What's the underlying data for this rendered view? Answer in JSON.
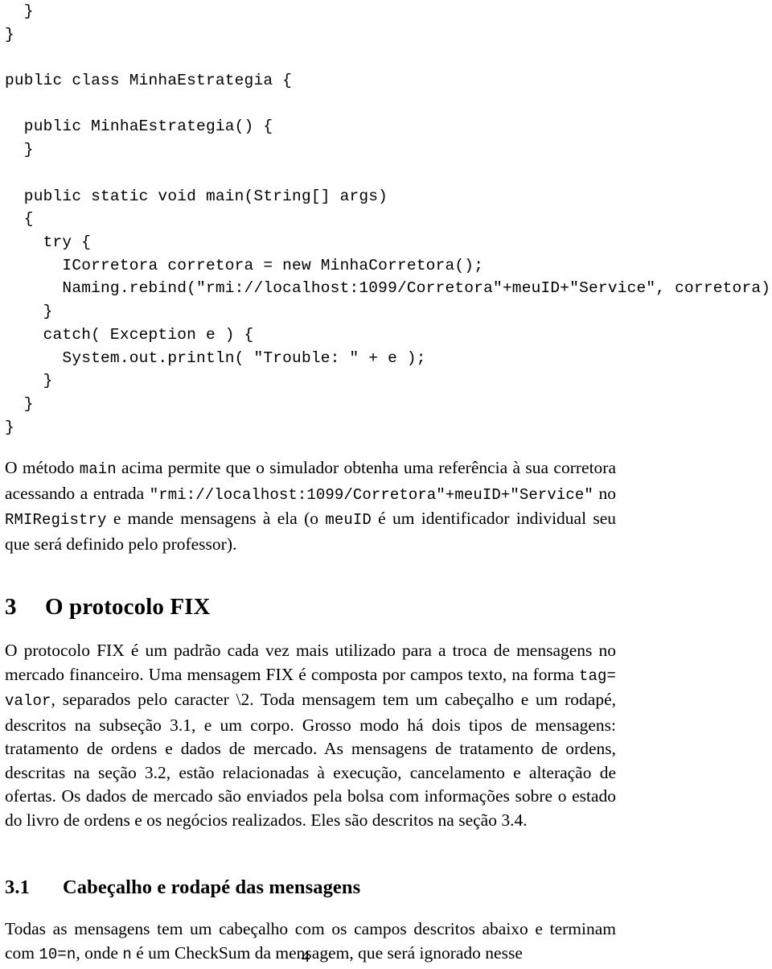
{
  "document": {
    "page_number": "4",
    "code_listing": {
      "language": "java",
      "lines": [
        "  }",
        "}",
        "",
        "public class MinhaEstrategia {",
        "",
        "  public MinhaEstrategia() {",
        "  }",
        "",
        "  public static void main(String[] args)",
        "  {",
        "    try {",
        "      ICorretora corretora = new MinhaCorretora();",
        "      Naming.rebind(\"rmi://localhost:1099/Corretora\"+meuID+\"Service\", corretora)",
        "    }",
        "    catch( Exception e ) {",
        "      System.out.println( \"Trouble: \" + e );",
        "    }",
        "  }",
        "}"
      ]
    },
    "paragraph_main": {
      "segments": [
        {
          "type": "text",
          "text": "O método "
        },
        {
          "type": "code",
          "text": "main"
        },
        {
          "type": "text",
          "text": " acima permite que o simulador obtenha uma referência à sua corretora acessando a entrada "
        },
        {
          "type": "code",
          "text": "\"rmi://localhost:1099/Corretora\"+meuID+\"Service\""
        },
        {
          "type": "text",
          "text": " no "
        },
        {
          "type": "code",
          "text": "RMIRegistry"
        },
        {
          "type": "text",
          "text": " e mande mensagens à ela (o "
        },
        {
          "type": "code",
          "text": "meuID"
        },
        {
          "type": "text",
          "text": " é um identificador individual seu que será definido pelo professor)."
        }
      ]
    },
    "section_fix": {
      "number": "3",
      "title": "O protocolo FIX",
      "paragraph_segments": [
        {
          "type": "text",
          "text": "O protocolo FIX é um padrão cada vez mais utilizado para a troca de mensagens no mercado financeiro. Uma mensagem FIX é composta por campos texto, na forma "
        },
        {
          "type": "code",
          "text": "tag= valor"
        },
        {
          "type": "text",
          "text": ", separados pelo caracter \\2. Toda mensagem tem um cabeçalho e um rodapé, descritos na subseção 3.1, e um corpo. Grosso modo há dois tipos de mensagens: tratamento de ordens e dados de mercado. As mensagens de tratamento de ordens, descritas na seção 3.2, estão relacionadas à execução, cancelamento e alteração de ofertas. Os dados de mercado são enviados pela bolsa com informações sobre o estado do livro de ordens e os negócios realizados. Eles são descritos na seção 3.4."
        }
      ]
    },
    "subsection_header": {
      "number": "3.1",
      "title": "Cabeçalho e rodapé das mensagens",
      "paragraph_segments": [
        {
          "type": "text",
          "text": "Todas as mensagens tem um cabeçalho com os campos descritos abaixo e terminam com "
        },
        {
          "type": "code",
          "text": "10=n"
        },
        {
          "type": "text",
          "text": ", onde "
        },
        {
          "type": "code",
          "text": "n"
        },
        {
          "type": "text",
          "text": " é um CheckSum da mensagem, que será ignorado nesse"
        }
      ]
    }
  }
}
